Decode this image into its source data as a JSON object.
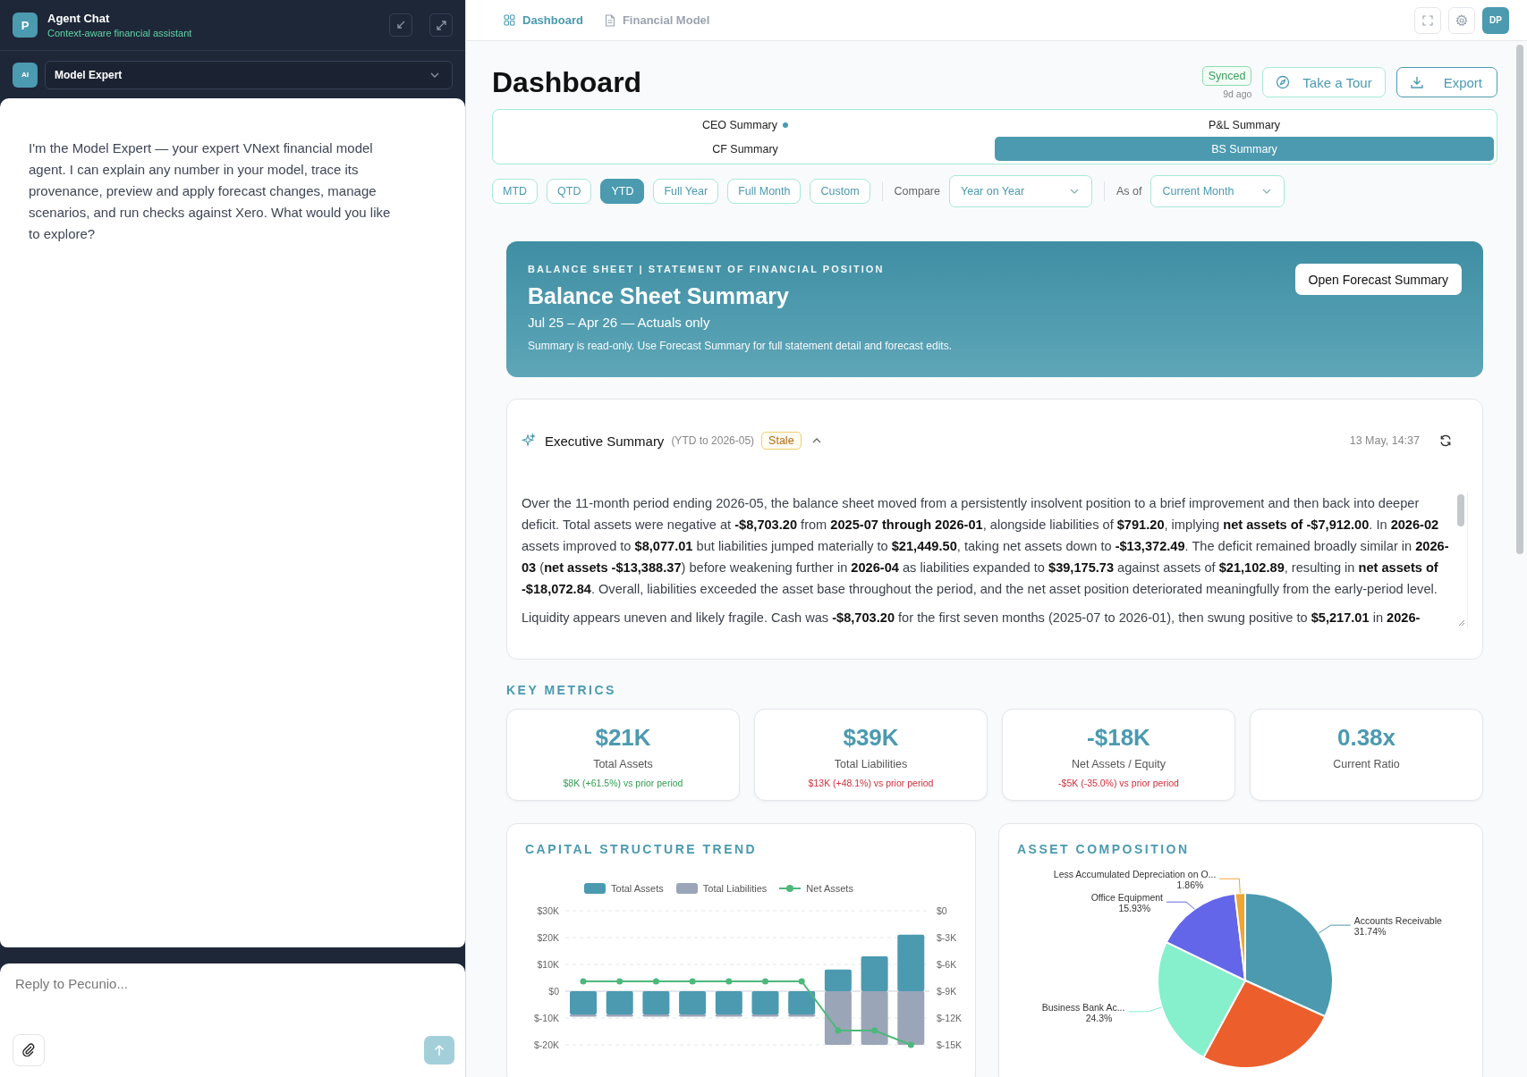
{
  "chat": {
    "avatar": "P",
    "title": "Agent Chat",
    "subtitle": "Context-aware financial assistant",
    "agent_badge": "AI",
    "agent": "Model Expert",
    "messages": [
      {
        "text": "I'm the Model Expert — your expert VNext financial model agent. I can explain any number in your model, trace its provenance, preview and apply forecast changes, manage scenarios, and run checks against Xero. What would you like to explore?"
      }
    ],
    "input": {
      "placeholder": "Reply to Pecunio..."
    }
  },
  "nav": {
    "tabs": [
      {
        "label": "Dashboard",
        "kind": "grid",
        "selected": true
      },
      {
        "label": "Financial Model",
        "kind": "document",
        "selected": false
      }
    ],
    "user_initials": "DP"
  },
  "page": {
    "title": "Dashboard",
    "sync": {
      "status": "Synced",
      "time": "9d ago"
    },
    "buttons": [
      {
        "label": "Take a Tour",
        "kind": "tour"
      },
      {
        "label": "Export",
        "kind": "export"
      }
    ]
  },
  "summary_tabs": [
    {
      "label": "CEO Summary",
      "dot": true,
      "selected": false
    },
    {
      "label": "P&L Summary",
      "dot": false,
      "selected": false
    },
    {
      "label": "CF Summary",
      "dot": false,
      "selected": false
    },
    {
      "label": "BS Summary",
      "dot": false,
      "selected": true
    }
  ],
  "periods": [
    {
      "label": "MTD",
      "selected": false
    },
    {
      "label": "QTD",
      "selected": false
    },
    {
      "label": "YTD",
      "selected": true
    },
    {
      "label": "Full Year",
      "selected": false
    },
    {
      "label": "Full Month",
      "selected": false
    },
    {
      "label": "Custom",
      "selected": false
    }
  ],
  "compare": {
    "label": "Compare",
    "value": "Year on Year"
  },
  "as_of": {
    "label": "As of",
    "value": "Current Month"
  },
  "banner": {
    "kicker": "BALANCE SHEET | STATEMENT OF FINANCIAL POSITION",
    "title": "Balance Sheet Summary",
    "subtitle": "Jul 25 – Apr 26 — Actuals only",
    "note": "Summary is read-only. Use Forecast Summary for full statement detail and forecast edits.",
    "button": "Open Forecast Summary"
  },
  "executive_summary": {
    "title": "Executive Summary",
    "scope": "(YTD to 2026-05)",
    "badge": "Stale",
    "expanded": true,
    "timestamp": "13 May, 14:37",
    "paragraphs": [
      "Over the 11-month period ending 2026-05, the balance sheet moved from a persistently insolvent position to a brief improvement and then back into deeper deficit. Total assets were negative at **-$8,703.20** from **2025-07 through 2026-01**, alongside liabilities of **$791.20**, implying **net assets of -$7,912.00**. In **2026-02** assets improved to **$8,077.01** but liabilities jumped materially to **$21,449.50**, taking net assets down to **-$13,372.49**. The deficit remained broadly similar in **2026-03** (**net assets -$13,388.37**) before weakening further in **2026-04** as liabilities expanded to **$39,175.73** against assets of **$21,102.89**, resulting in **net assets of -$18,072.84**. Overall, liabilities exceeded the asset base throughout the period, and the net asset position deteriorated meaningfully from the early-period level.",
      "Liquidity appears uneven and likely fragile. Cash was **-$8,703.20** for the first seven months (2025-07 to 2026-01), then swung positive to **$5,217.01** in **2026-**"
    ]
  },
  "key_metrics": {
    "title": "KEY METRICS",
    "items": [
      {
        "value": "$21K",
        "label": "Total Assets",
        "change": "$8K (+61.5%) vs prior period",
        "color": "#2f9e4f"
      },
      {
        "value": "$39K",
        "label": "Total Liabilities",
        "change": "$13K (+48.1%) vs prior period",
        "color": "#d0303a"
      },
      {
        "value": "-$18K",
        "label": "Net Assets / Equity",
        "change": "-$5K (-35.0%) vs prior period",
        "color": "#d0303a"
      },
      {
        "value": "0.38x",
        "label": "Current Ratio"
      }
    ]
  },
  "capital_structure": {
    "title": "CAPITAL STRUCTURE TREND",
    "chart_data": {
      "type": "bar",
      "stacked": true,
      "ylim": [
        -20000,
        30000
      ],
      "y2lim": [
        -15000,
        0
      ],
      "grid": true,
      "series": [
        {
          "name": "Total Assets",
          "color": "#4b9ab0",
          "values": [
            -8700,
            -8700,
            -8700,
            -8700,
            -8700,
            -8700,
            -8700,
            8100,
            13000,
            21100
          ]
        },
        {
          "name": "Total Liabilities",
          "color": "#9aa5b8",
          "values": [
            -800,
            -800,
            -800,
            -800,
            -800,
            -800,
            -800,
            -20000,
            -20000,
            -20000
          ]
        },
        {
          "name": "Net Assets",
          "color": "#4cb87a",
          "type": "line",
          "axis": "y2",
          "marker": "circle",
          "values": [
            -7900,
            -7900,
            -7900,
            -7900,
            -7900,
            -7900,
            -7900,
            -13400,
            -13400,
            -15000
          ]
        }
      ],
      "yticks": [
        {
          "value": 30000,
          "label": "$30K"
        },
        {
          "value": 20000,
          "label": "$20K"
        },
        {
          "value": 10000,
          "label": "$10K"
        },
        {
          "value": 0,
          "label": "$0"
        },
        {
          "value": -10000,
          "label": "$-10K"
        },
        {
          "value": -20000,
          "label": "$-20K"
        }
      ],
      "y2ticks": [
        {
          "value": 0,
          "label": "$0"
        },
        {
          "value": -3000,
          "label": "$-3K"
        },
        {
          "value": -6000,
          "label": "$-6K"
        },
        {
          "value": -9000,
          "label": "$-9K"
        },
        {
          "value": -12000,
          "label": "$-12K"
        },
        {
          "value": -15000,
          "label": "$-15K"
        }
      ]
    }
  },
  "asset_composition": {
    "title": "ASSET COMPOSITION",
    "chart_data": {
      "type": "pie",
      "categories": [
        "Accounts Receivable",
        null,
        "Business Bank Ac...",
        "Office Equipment",
        "Less Accumulated Depreciation on O..."
      ],
      "values": [
        31.74,
        26.17,
        24.3,
        15.93,
        1.86
      ],
      "colors": [
        "#4b9ab0",
        "#ec5f2c",
        "#86efcc",
        "#6366e8",
        "#f0a531"
      ],
      "value_labels": [
        "31.74%",
        null,
        "24.3%",
        "15.93%",
        "1.86%"
      ]
    }
  }
}
